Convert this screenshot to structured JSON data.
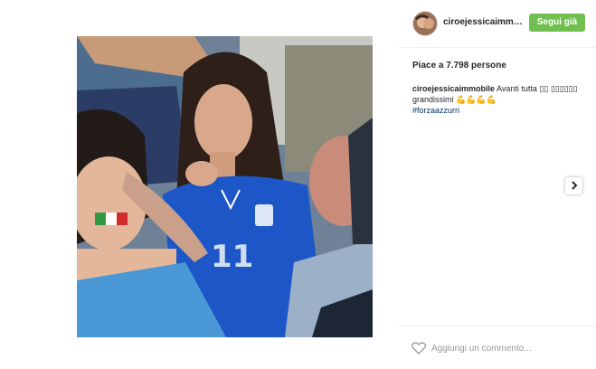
{
  "post": {
    "image_alt": "Photo of a woman in a blue Italy jersey in a stadium crowd"
  },
  "header": {
    "username": "ciroejessicaimmo...",
    "follow_label": "Segui già"
  },
  "likes": {
    "text": "Piace a 7.798 persone"
  },
  "caption": {
    "user": "ciroejessicaimmobile",
    "text": " Avanti tutta ▯▯ ▯▯▯▯▯▯ grandissimi 💪💪💪💪",
    "hashtag": "#forzaazzurri"
  },
  "comment": {
    "placeholder": "Aggiungi un commento..."
  },
  "icons": {
    "next": "chevron-right-icon",
    "like": "heart-icon"
  },
  "colors": {
    "follow_bg": "#70c050",
    "hashtag": "#003569"
  }
}
